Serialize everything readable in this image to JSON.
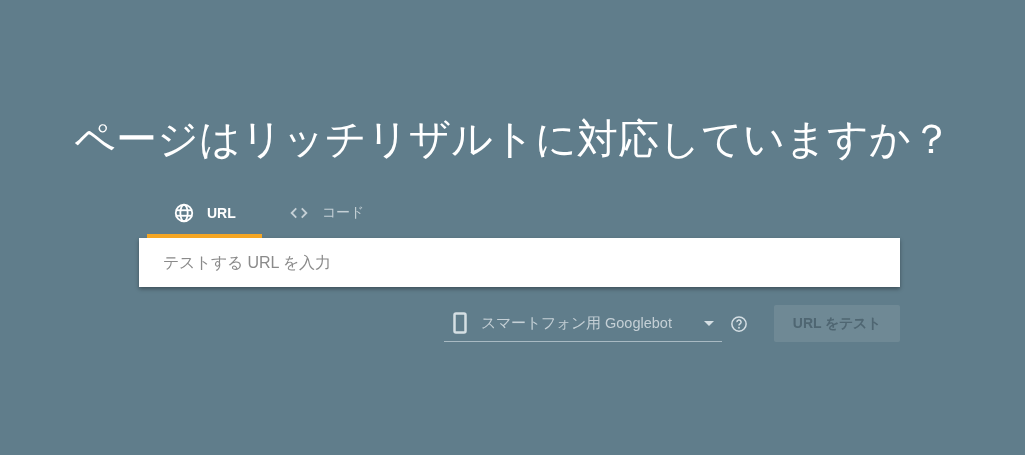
{
  "heading": "ページはリッチリザルトに対応していますか？",
  "tabs": [
    {
      "kind": "url",
      "label": "URL",
      "selected": true
    },
    {
      "kind": "code",
      "label": "コード",
      "selected": false
    }
  ],
  "url_field": {
    "placeholder": "テストする URL を入力"
  },
  "crawler_select": {
    "value": "スマートフォン用 Googlebot"
  },
  "test_button": {
    "label": "URL をテスト",
    "disabled": true
  }
}
